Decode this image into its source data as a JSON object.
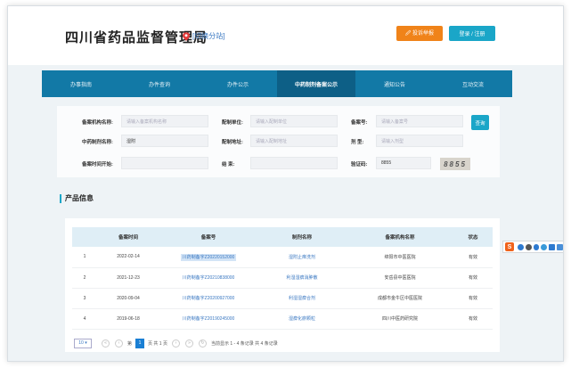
{
  "header": {
    "title": "四川省药品监督管理局",
    "location_label": "[切换分站]",
    "report_button": "🖉 投诉举报",
    "login_button": "登录 / 注册"
  },
  "nav": {
    "items": [
      "办事指南",
      "办件查询",
      "办件公示",
      "中药制剂备案公示",
      "通知公告",
      "互动交流"
    ],
    "active_index": 3
  },
  "search": {
    "org_label": "备案机构名称:",
    "org_placeholder": "请输入备案机构名称",
    "prep_unit_label": "配制单位:",
    "prep_unit_placeholder": "请输入配制单位",
    "record_no_label": "备案号:",
    "record_no_placeholder": "请输入备案号",
    "drug_name_label": "中药制剂名称:",
    "drug_name_value": "湿附",
    "prep_addr_label": "配制地址:",
    "prep_addr_placeholder": "请输入配制地址",
    "form_label": "剂  型:",
    "form_placeholder": "请输入剂型",
    "start_label": "备案时间开始:",
    "end_label": "结  束:",
    "captcha_label": "验证码:",
    "captcha_value": "8855",
    "captcha_image_text": "8855",
    "query_button": "查询"
  },
  "section": {
    "title": "产品信息"
  },
  "table": {
    "headers": [
      "",
      "备案时间",
      "备案号",
      "制剂名称",
      "备案机构名称",
      "状态"
    ],
    "rows": [
      {
        "idx": "1",
        "date": "2022-02-14",
        "reg": "川药制备字Z20220152000",
        "name": "湿附止痒洗剂",
        "org": "绵阳市中医医院",
        "status": "有效"
      },
      {
        "idx": "2",
        "date": "2021-12-23",
        "reg": "川药制备字Z20210838000",
        "name": "利湿湿痹消肿散",
        "org": "安岳县中医医院",
        "status": "有效"
      },
      {
        "idx": "3",
        "date": "2020-09-04",
        "reg": "川药制备字Z20200927000",
        "name": "利湿湿痹合剂",
        "org": "成都市金牛区中医医院",
        "status": "有效"
      },
      {
        "idx": "4",
        "date": "2019-06-18",
        "reg": "川药制备字Z20190245000",
        "name": "湿痹化瘀颗粒",
        "org": "四川中医药研究院",
        "status": "有效"
      }
    ],
    "selected_row": 0
  },
  "pager": {
    "page_size": "10 ▾",
    "prev": "‹",
    "goto_prefix": "第",
    "current_page": "1",
    "page_suffix": "页 共 1 页",
    "next": "›",
    "refresh": "↻",
    "summary": "当前显示 1 - 4 条记录 共 4 条记录"
  },
  "toolbar": {
    "logo": "S"
  }
}
